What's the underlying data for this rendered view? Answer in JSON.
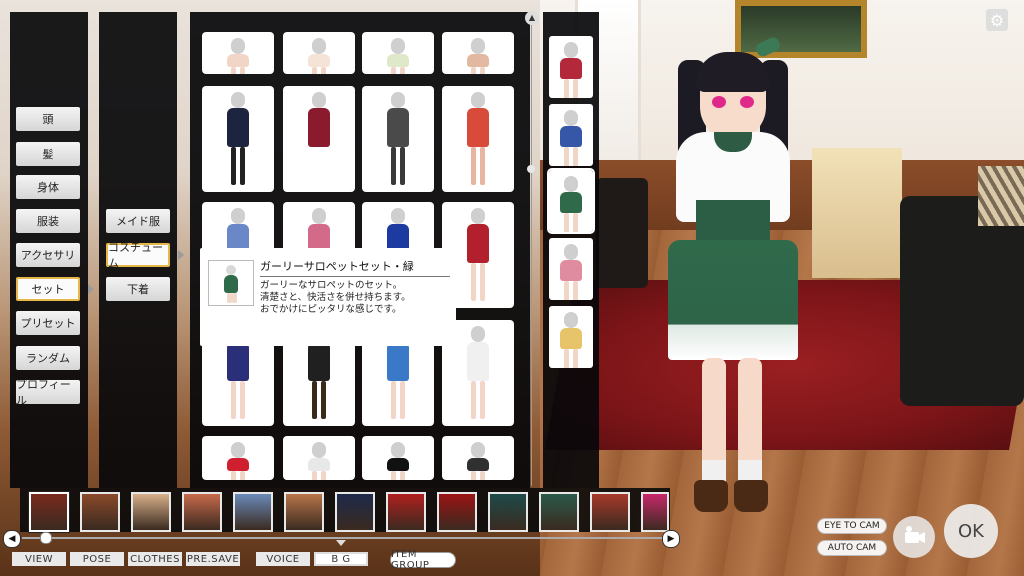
{
  "categories": [
    {
      "label": "頭"
    },
    {
      "label": "髪"
    },
    {
      "label": "身体"
    },
    {
      "label": "服装"
    },
    {
      "label": "アクセサリ"
    },
    {
      "label": "セット",
      "selected": true
    },
    {
      "label": "プリセット"
    },
    {
      "label": "ランダム"
    },
    {
      "label": "プロフィール"
    }
  ],
  "subcategories": [
    {
      "label": "メイド服"
    },
    {
      "label": "コスチューム",
      "selected": true
    },
    {
      "label": "下着"
    }
  ],
  "tooltip": {
    "title": "ガーリーサロペットセット・緑",
    "desc_line1": "ガーリーなサロペットのセット。",
    "desc_line2": "清楚さと、快活さを併せ持ちます。",
    "desc_line3": "おでかけにピッタリな感じです。"
  },
  "tabs": {
    "view": "VIEW",
    "pose": "POSE",
    "clothes": "CLOTHES",
    "pre_save": "PRE.SAVE",
    "voice": "VOICE",
    "bg": "B G",
    "item_group": "ITEM GROUP"
  },
  "camera": {
    "eye_to_cam": "EYE TO CAM",
    "auto_cam": "AUTO CAM"
  },
  "ok_label": "OK",
  "colors": {
    "selected_border": "#e6b84a",
    "panel_bg": "#08080a"
  }
}
